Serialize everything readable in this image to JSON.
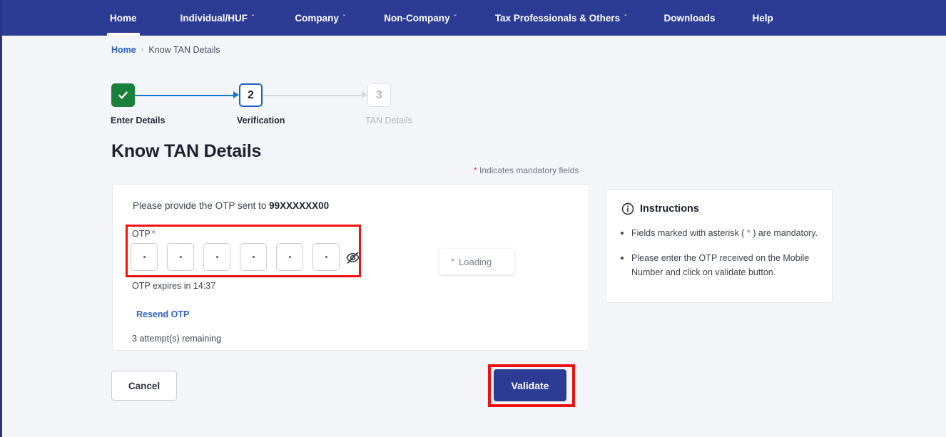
{
  "colors": {
    "nav_bg": "#2c3c95",
    "page_bg": "#f4f5f9",
    "accent_blue": "#2f62bf",
    "step_done_green": "#18803a",
    "step_current_blue": "#1664c0",
    "required_red": "#d93b3b",
    "annotation_red": "#ee1111",
    "primary_button": "#2c3c95"
  },
  "nav": {
    "items": [
      {
        "label": "Home",
        "has_caret": false,
        "active": true
      },
      {
        "label": "Individual/HUF",
        "has_caret": true,
        "active": false
      },
      {
        "label": "Company",
        "has_caret": true,
        "active": false
      },
      {
        "label": "Non-Company",
        "has_caret": true,
        "active": false
      },
      {
        "label": "Tax Professionals & Others",
        "has_caret": true,
        "active": false
      },
      {
        "label": "Downloads",
        "has_caret": false,
        "active": false
      },
      {
        "label": "Help",
        "has_caret": false,
        "active": false
      }
    ],
    "caret_glyph": "ˇ"
  },
  "breadcrumb": {
    "home": "Home",
    "separator": "›",
    "current": "Know TAN Details"
  },
  "stepper": {
    "steps": [
      {
        "number": "1",
        "label": "Enter Details",
        "state": "done",
        "icon": "check-icon"
      },
      {
        "number": "2",
        "label": "Verification",
        "state": "current"
      },
      {
        "number": "3",
        "label": "TAN Details",
        "state": "upcoming"
      }
    ]
  },
  "page": {
    "title": "Know TAN Details",
    "mandatory_note_asterisk": "*",
    "mandatory_note_text": " Indicates mandatory fields"
  },
  "otp_card": {
    "sent_prefix": "Please provide the OTP sent to ",
    "masked_mobile": "99XXXXXX00",
    "field_label": "OTP",
    "field_label_asterisk": "*",
    "boxes": [
      {
        "value": "•"
      },
      {
        "value": "•"
      },
      {
        "value": "•"
      },
      {
        "value": "•"
      },
      {
        "value": "•"
      },
      {
        "value": "•"
      }
    ],
    "toggle_icon": "eye-slash-icon",
    "expiry_text": "OTP expires in 14:37",
    "resend_label": "Resend OTP",
    "attempts_text": "3 attempt(s) remaining"
  },
  "loading_chip": {
    "label": "Loading",
    "icon": "spinner-icon"
  },
  "instructions": {
    "icon": "info-icon",
    "title": "Instructions",
    "items": [
      {
        "before": "Fields marked with asterisk ( ",
        "asterisk": "*",
        "after": " ) are mandatory."
      },
      {
        "before": "Please enter the OTP received on the Mobile Number and click on validate button.",
        "asterisk": "",
        "after": ""
      }
    ]
  },
  "actions": {
    "cancel_label": "Cancel",
    "validate_label": "Validate"
  },
  "annotations": [
    {
      "name": "otp-input-group-highlight",
      "color": "#ee1111"
    },
    {
      "name": "validate-button-highlight",
      "color": "#ee1111"
    }
  ]
}
